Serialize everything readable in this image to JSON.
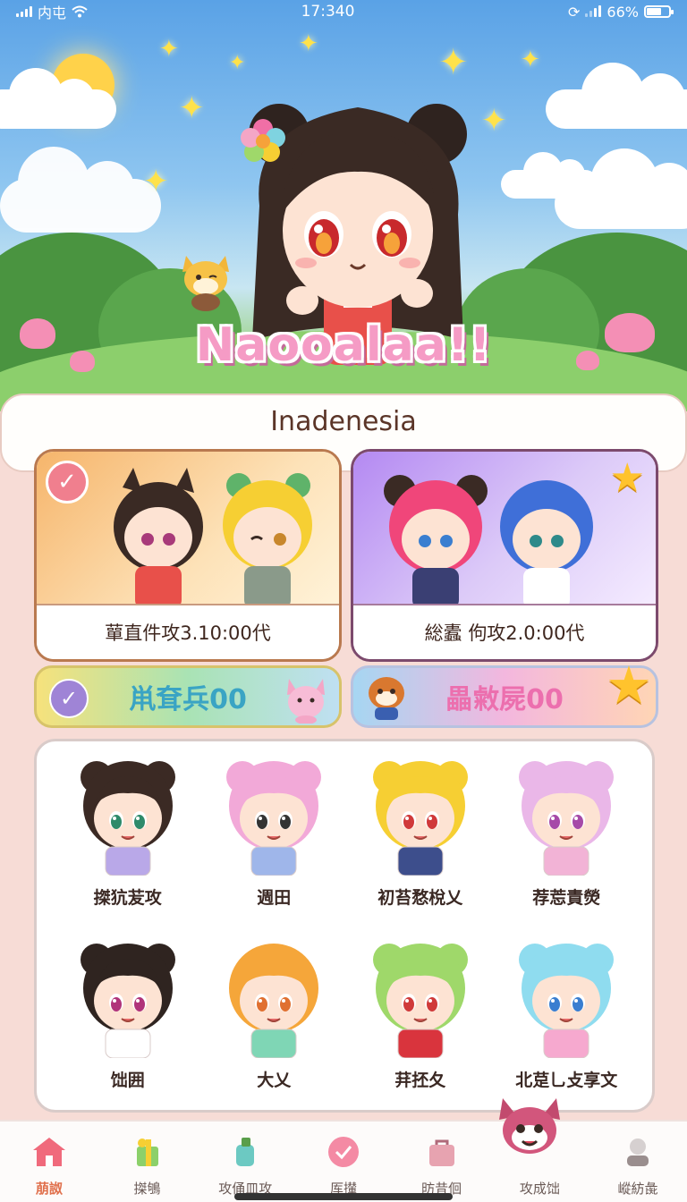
{
  "status_bar": {
    "carrier": "内屯",
    "time": "17:340",
    "battery": "66%",
    "battery_level": 0.66
  },
  "hero": {
    "title": "Naooalaa!!"
  },
  "region": {
    "title": "Inadenesia"
  },
  "promos": [
    {
      "caption": "蕇直件攻3.10:00代",
      "badge": "check-icon"
    },
    {
      "caption": "総蠹 佝攻2.0:00代",
      "badge": "star-icon"
    }
  ],
  "bonuses": [
    {
      "label": "鼡耷兵00",
      "color": "#3aa4c4"
    },
    {
      "label": "畾敹屍00",
      "color": "#ec6fae"
    }
  ],
  "characters": [
    {
      "name": "搩犺苃攻",
      "hair": "#3b2a24",
      "buns": true,
      "eyes": "#2e8a6a",
      "outfit": "#b9a8e8"
    },
    {
      "name": "週田",
      "hair": "#f2a9d8",
      "buns": true,
      "eyes": "#333333",
      "outfit": "#9fb6ea"
    },
    {
      "name": "初苔愗梲乂",
      "hair": "#f6cf33",
      "buns": true,
      "eyes": "#d0393a",
      "outfit": "#3d4e8c"
    },
    {
      "name": "荐莣責熒",
      "hair": "#eab7e8",
      "buns": true,
      "eyes": "#a64aa8",
      "outfit": "#f2b3d6"
    },
    {
      "name": "饳囲",
      "hair": "#2f2420",
      "buns": true,
      "eyes": "#b0337a",
      "outfit": "#ffffff"
    },
    {
      "name": "大乂",
      "hair": "#f5a63a",
      "buns": false,
      "eyes": "#e07030",
      "outfit": "#7fd6b5"
    },
    {
      "name": "荓抷夂",
      "hair": "#9fd86a",
      "buns": true,
      "eyes": "#d03a3a",
      "outfit": "#d9343d"
    },
    {
      "name": "北莡乚攴享文",
      "hair": "#8fdcef",
      "buns": true,
      "eyes": "#3a7ed0",
      "outfit": "#f6a9cf"
    }
  ],
  "nav": [
    {
      "label": "萠詉",
      "icon": "home-icon",
      "active": true
    },
    {
      "label": "搩鴝",
      "icon": "gift-icon",
      "active": false
    },
    {
      "label": "攻俑皿攻",
      "icon": "bottle-icon",
      "active": false
    },
    {
      "label": "厍攆",
      "icon": "check-circle-icon",
      "active": false
    },
    {
      "label": "昉昔佪",
      "icon": "bag-icon",
      "active": false
    },
    {
      "label": "攻成饳",
      "icon": "mascot-icon",
      "active": false
    },
    {
      "label": "嵷紡彘",
      "icon": "profile-icon",
      "active": false
    }
  ],
  "colors": {
    "accent": "#e0704c",
    "page_bg": "#f7dcd6"
  }
}
